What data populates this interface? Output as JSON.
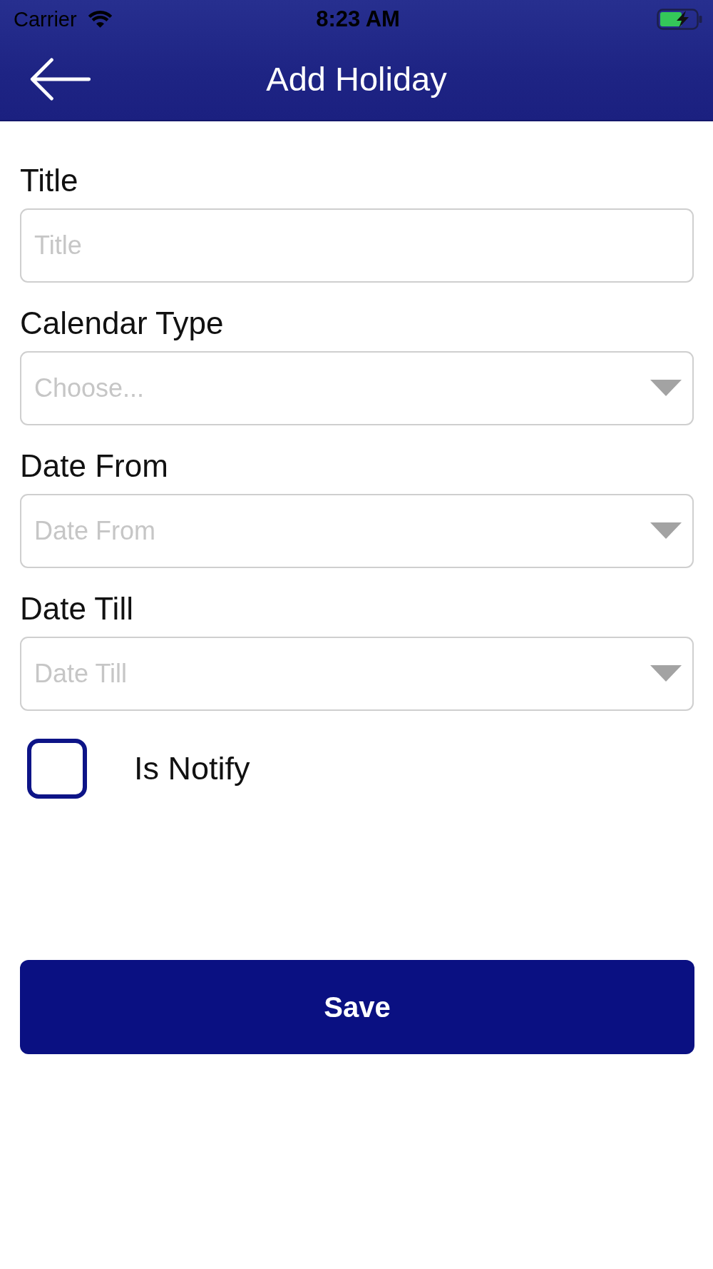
{
  "status_bar": {
    "carrier": "Carrier",
    "time": "8:23 AM",
    "charging": true
  },
  "header": {
    "title": "Add Holiday"
  },
  "fields": [
    {
      "kind": "text",
      "label": "Title",
      "placeholder": "Title"
    },
    {
      "kind": "dropdown",
      "label": "Calendar Type",
      "placeholder": "Choose..."
    },
    {
      "kind": "dropdown",
      "label": "Date From",
      "placeholder": "Date From"
    },
    {
      "kind": "dropdown",
      "label": "Date Till",
      "placeholder": "Date Till"
    }
  ],
  "notify_checkbox": {
    "label": "Is Notify",
    "checked": false
  },
  "save_button": {
    "label": "Save"
  }
}
